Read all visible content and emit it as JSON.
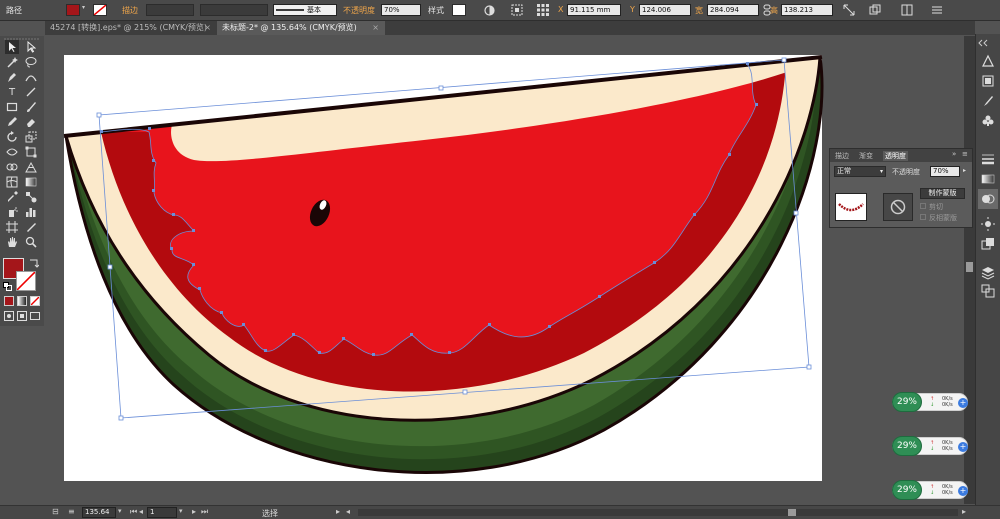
{
  "control_bar": {
    "object_type": "路径",
    "stroke_label": "描边",
    "stroke_profile": "基本",
    "opacity_label": "不透明度",
    "opacity_value": "70%",
    "style_label": "样式",
    "x_label": "X",
    "x_value": "91.115 mm",
    "y_label": "Y",
    "y_value": "124.006",
    "w_label": "宽",
    "w_value": "284.094",
    "h_label": "高",
    "h_value": "138.213",
    "fill_color": "#a4161a"
  },
  "tabs": [
    {
      "label": "45274 [转换].eps* @ 215% (CMYK/预览)",
      "active": false
    },
    {
      "label": "未标题-2* @ 135.64% (CMYK/预览)",
      "active": true
    }
  ],
  "transparency_panel": {
    "tabs": [
      "描边",
      "渐变",
      "透明度"
    ],
    "blend_mode": "正常",
    "opacity_label": "不透明度",
    "opacity_value": "70%",
    "make_mask_button": "制作蒙版",
    "clip_label": "剪切",
    "invert_mask_label": "反相蒙版"
  },
  "status_bar": {
    "zoom": "135.64",
    "artboard": "1",
    "tool_status": "选择"
  },
  "network_widgets": [
    {
      "percent": "29%",
      "upload": "0K/s",
      "download": "0K/s"
    },
    {
      "percent": "29%",
      "upload": "0K/s",
      "download": "0K/s"
    },
    {
      "percent": "29%",
      "upload": "0K/s",
      "download": "0K/s"
    }
  ],
  "colors": {
    "watermelon_flesh": "#e8141c",
    "watermelon_inner_rind": "#b30a0e",
    "watermelon_pith": "#fbe9cb",
    "watermelon_skin_light": "#3f6a2f",
    "watermelon_skin_dark": "#25441c",
    "outline": "#1a0606",
    "selection": "#6a8ed8"
  }
}
